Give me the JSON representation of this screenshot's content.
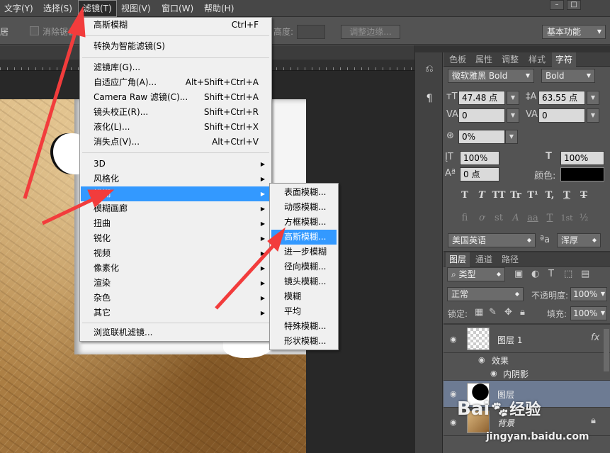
{
  "menubar": {
    "items": [
      "文字(Y)",
      "选择(S)",
      "滤镜(T)",
      "视图(V)",
      "窗口(W)",
      "帮助(H)"
    ],
    "window_controls": [
      "–",
      "□"
    ]
  },
  "options_bar": {
    "partial_left": "居",
    "antialias_label": "消除锯齿",
    "height_label": "高度:",
    "refine_edge_button": "调整边缘...",
    "workspace": "基本功能"
  },
  "filter_menu": {
    "items": [
      {
        "label": "高斯模糊",
        "shortcut": "Ctrl+F"
      },
      {
        "label": "转换为智能滤镜(S)",
        "shortcut": ""
      },
      {
        "label": "滤镜库(G)...",
        "shortcut": ""
      },
      {
        "label": "自适应广角(A)...",
        "shortcut": "Alt+Shift+Ctrl+A"
      },
      {
        "label": "Camera Raw 滤镜(C)...",
        "shortcut": "Shift+Ctrl+A"
      },
      {
        "label": "镜头校正(R)...",
        "shortcut": "Shift+Ctrl+R"
      },
      {
        "label": "液化(L)...",
        "shortcut": "Shift+Ctrl+X"
      },
      {
        "label": "消失点(V)...",
        "shortcut": "Alt+Ctrl+V"
      },
      {
        "label": "3D",
        "shortcut": ""
      },
      {
        "label": "风格化",
        "shortcut": ""
      },
      {
        "label": "模糊",
        "shortcut": ""
      },
      {
        "label": "模糊画廊",
        "shortcut": ""
      },
      {
        "label": "扭曲",
        "shortcut": ""
      },
      {
        "label": "锐化",
        "shortcut": ""
      },
      {
        "label": "视频",
        "shortcut": ""
      },
      {
        "label": "像素化",
        "shortcut": ""
      },
      {
        "label": "渲染",
        "shortcut": ""
      },
      {
        "label": "杂色",
        "shortcut": ""
      },
      {
        "label": "其它",
        "shortcut": ""
      },
      {
        "label": "浏览联机滤镜...",
        "shortcut": ""
      }
    ]
  },
  "blur_submenu": {
    "items": [
      "表面模糊...",
      "动感模糊...",
      "方框模糊...",
      "高斯模糊...",
      "进一步模糊",
      "径向模糊...",
      "镜头模糊...",
      "模糊",
      "平均",
      "特殊模糊...",
      "形状模糊..."
    ]
  },
  "side_icons": [
    "history-icon",
    "paragraph-style-icon"
  ],
  "character_panel": {
    "tabs": [
      "色板",
      "属性",
      "调整",
      "样式",
      "字符"
    ],
    "font_family": "微软雅黑 Bold",
    "font_style": "Bold",
    "font_size": "47.48 点",
    "leading": "63.55 点",
    "kerning": "0",
    "tracking": "0",
    "tsume": "0%",
    "vertical_scale": "100%",
    "horizontal_scale": "100%",
    "baseline_shift": "0 点",
    "color_label": "颜色:",
    "color_value": "#000000",
    "type_buttons_row1": [
      "T",
      "T",
      "TT",
      "Tr",
      "T¹",
      "T,",
      "T",
      "T"
    ],
    "type_buttons_row2": [
      "fi",
      "ơ",
      "st",
      "A",
      "aa",
      "T",
      "1st",
      "½"
    ],
    "language": "美国英语",
    "aa_label": "ªa",
    "antialias": "浑厚"
  },
  "layers_panel": {
    "tabs": [
      "图层",
      "通道",
      "路径"
    ],
    "filter_kind": "类型",
    "blend_mode": "正常",
    "opacity_label": "不透明度:",
    "opacity": "100%",
    "lock_label": "锁定:",
    "fill_label": "填充:",
    "fill": "100%",
    "fx_label": "fx",
    "layers": [
      {
        "name": "图层 1"
      },
      {
        "name": "效果"
      },
      {
        "name": "内阴影"
      },
      {
        "name": "图层"
      },
      {
        "name": "背景"
      }
    ]
  },
  "watermark": {
    "brand": "Bai",
    "brand2": "经验",
    "url": "jingyan.baidu.com"
  }
}
